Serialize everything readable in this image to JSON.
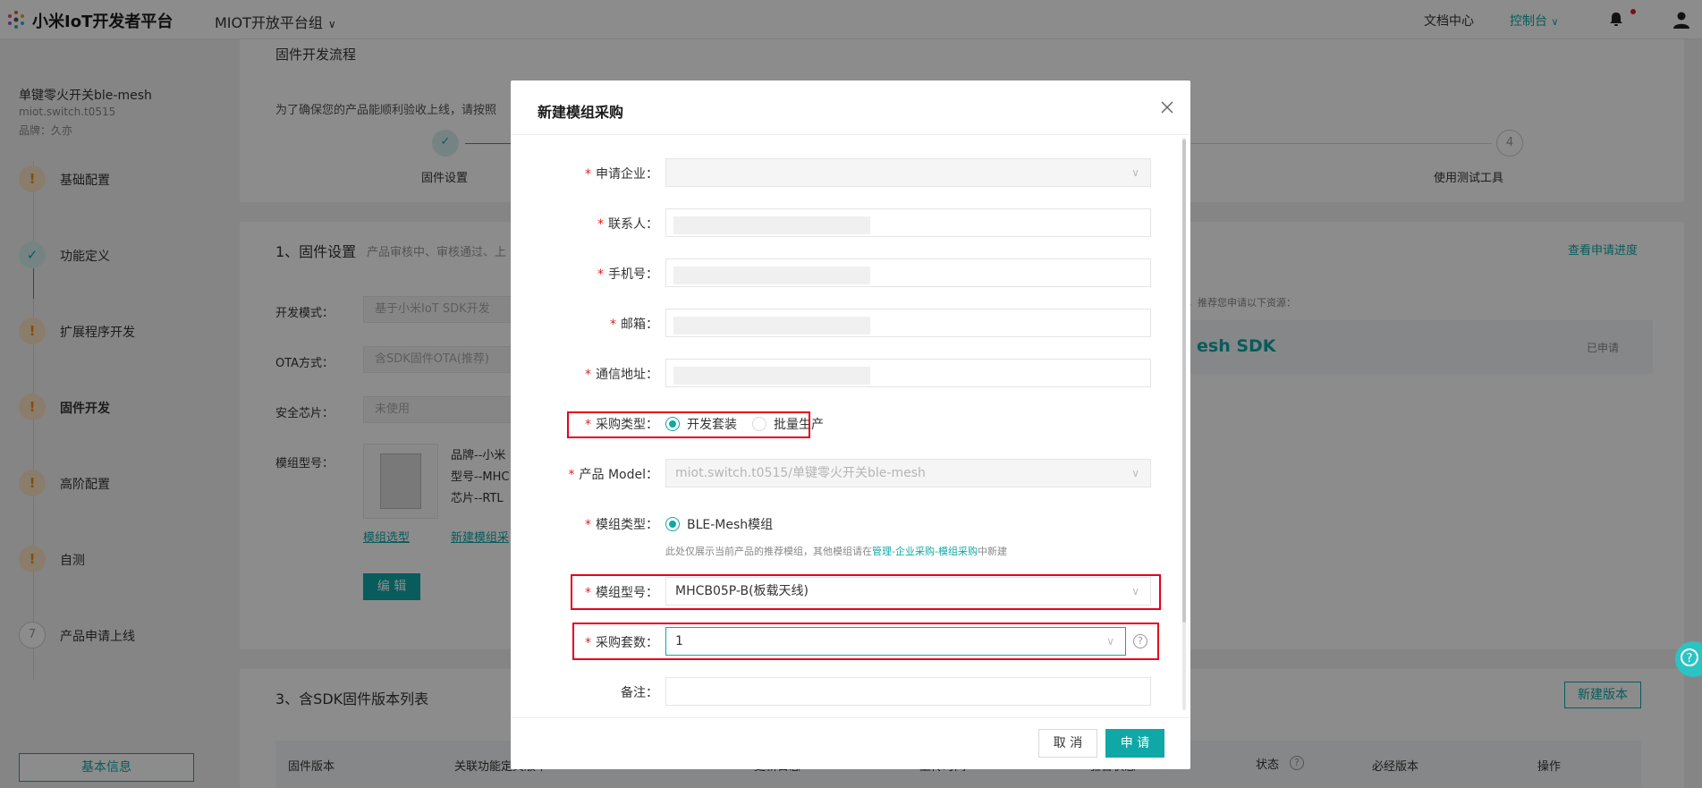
{
  "topbar": {
    "brand": "小米IoT开发者平台",
    "org": "MIOT开放平台组",
    "docs": "文档中心",
    "console": "控制台"
  },
  "sidebar": {
    "product_name": "单键零火开关ble-mesh",
    "product_model": "miot.switch.t0515",
    "product_brand": "品牌：久亦",
    "steps": [
      {
        "label": "基础配置",
        "state": "warn"
      },
      {
        "label": "功能定义",
        "state": "ok"
      },
      {
        "label": "扩展程序开发",
        "state": "warn"
      },
      {
        "label": "固件开发",
        "state": "warn"
      },
      {
        "label": "高阶配置",
        "state": "warn"
      },
      {
        "label": "自测",
        "state": "warn"
      },
      {
        "label": "产品申请上线",
        "state": "num",
        "num": "7"
      }
    ],
    "basic_info_btn": "基本信息"
  },
  "main": {
    "flow_title": "固件开发流程",
    "flow_desc": "为了确保您的产品能顺利验收上线，请按照",
    "flow_step1": "固件设置",
    "flow_step4_num": "4",
    "flow_step4": "使用测试工具",
    "section1_title": "1、固件设置",
    "section1_desc": "产品审核中、审核通过、上",
    "view_progress": "查看申请进度",
    "dev_mode_label": "开发模式：",
    "dev_mode_value": "基于小米IoT SDK开发",
    "ota_label": "OTA方式：",
    "ota_value": "含SDK固件OTA(推荐)",
    "chip_label": "安全芯片：",
    "chip_value": "未使用",
    "module_label": "模组型号：",
    "module_brand": "品牌--小米",
    "module_model": "型号--MHC",
    "module_chip": "芯片--RTL",
    "module_select_link": "模组选型",
    "module_buy_link": "新建模组采",
    "edit_btn": "编 辑",
    "resource_tip": "，推荐您申请以下资源：",
    "sdk_name": "esh SDK",
    "sdk_status": "已申请",
    "section3_title": "3、含SDK固件版本列表",
    "new_version_btn": "新建版本",
    "table_headers": [
      "固件版本",
      "关联功能定义版本",
      "更新日志",
      "上传时间",
      "验合状态",
      "状态",
      "必经版本",
      "操作"
    ]
  },
  "modal": {
    "title": "新建模组采购",
    "fields": {
      "company_label": "申请企业",
      "contact_label": "联系人",
      "phone_label": "手机号",
      "email_label": "邮箱",
      "address_label": "通信地址",
      "purchase_type_label": "采购类型",
      "purchase_type_opt1": "开发套装",
      "purchase_type_opt2": "批量生产",
      "product_model_label": "产品 Model",
      "product_model_value": "miot.switch.t0515/单键零火开关ble-mesh",
      "module_type_label": "模组类型",
      "module_type_value": "BLE-Mesh模组",
      "hint_prefix": "此处仅展示当前产品的推荐模组，其他模组请在",
      "hint_link": "管理-企业采购-模组采购",
      "hint_suffix": "中新建",
      "module_model_label": "模组型号",
      "module_model_value": "MHCB05P-B(板载天线)",
      "qty_label": "采购套数",
      "qty_value": "1",
      "remark_label": "备注"
    },
    "cancel": "取 消",
    "submit": "申 请"
  },
  "colors": {
    "accent": "#0fa8a7",
    "required": "#e02020",
    "highlight_box": "#e8001c"
  }
}
